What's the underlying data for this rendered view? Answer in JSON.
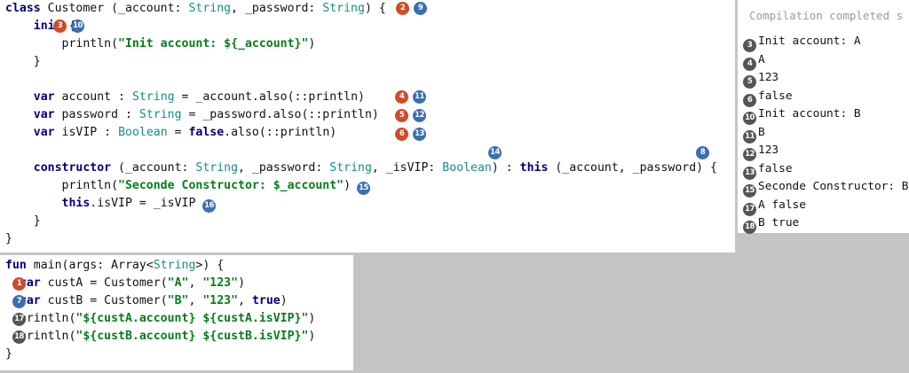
{
  "class_code": [
    [
      "kw:class",
      " Customer (_account: ",
      "ty:String",
      ", _password: ",
      "ty:String",
      ") {"
    ],
    [
      "    ",
      "kw:init",
      " {"
    ],
    [
      "        println(",
      "st:\"Init account: ${_account}\"",
      ")"
    ],
    [
      "    }"
    ],
    [
      ""
    ],
    [
      "    ",
      "kw:var",
      " account : ",
      "ty:String",
      " = _account.also(::println)"
    ],
    [
      "    ",
      "kw:var",
      " password : ",
      "ty:String",
      " = _password.also(::println)"
    ],
    [
      "    ",
      "kw:var",
      " isVIP : ",
      "ty:Boolean",
      " = ",
      "kw:false",
      ".also(::println)"
    ],
    [
      ""
    ],
    [
      "    ",
      "kw:constructor",
      " (_account: ",
      "ty:String",
      ", _password: ",
      "ty:String",
      ", _isVIP: ",
      "ty:Boolean",
      ") : ",
      "kw:this",
      " (_account, _password) {"
    ],
    [
      "        println(",
      "st:\"Seconde Constructor: $_account\"",
      ")"
    ],
    [
      "        ",
      "kw:this",
      ".isVIP = _isVIP"
    ],
    [
      "    }"
    ],
    [
      "}"
    ]
  ],
  "main_code": [
    [
      "kw:fun",
      " main(args: Array<",
      "ty:String",
      ">) {"
    ],
    [
      "  ",
      "kw:var",
      " custA = Customer(",
      "st:\"A\"",
      ", ",
      "st:\"123\"",
      ")"
    ],
    [
      "  ",
      "kw:var",
      " custB = Customer(",
      "st:\"B\"",
      ", ",
      "st:\"123\"",
      ", ",
      "kw:true",
      ")"
    ],
    [
      "  println(",
      "st:\"${custA.account} ${custA.isVIP}\"",
      ")"
    ],
    [
      "  println(",
      "st:\"${custB.account} ${custB.isVIP}\"",
      ")"
    ],
    [
      "}"
    ]
  ],
  "code_badges": [
    {
      "num": "2",
      "color": "red"
    },
    {
      "num": "9",
      "color": "blue"
    },
    {
      "num": "3",
      "color": "red"
    },
    {
      "num": "10",
      "color": "blue"
    },
    {
      "num": "4",
      "color": "red"
    },
    {
      "num": "11",
      "color": "blue"
    },
    {
      "num": "5",
      "color": "red"
    },
    {
      "num": "12",
      "color": "blue"
    },
    {
      "num": "6",
      "color": "red"
    },
    {
      "num": "13",
      "color": "blue"
    },
    {
      "num": "14",
      "color": "blue"
    },
    {
      "num": "8",
      "color": "blue"
    },
    {
      "num": "15",
      "color": "blue"
    },
    {
      "num": "16",
      "color": "blue"
    },
    {
      "num": "1",
      "color": "red"
    },
    {
      "num": "7",
      "color": "blue"
    },
    {
      "num": "17",
      "color": "gray"
    },
    {
      "num": "18",
      "color": "gray"
    }
  ],
  "output_panel": {
    "status": "Compilation completed s",
    "lines": [
      {
        "num": "3",
        "text": "Init account: A"
      },
      {
        "num": "4",
        "text": "A"
      },
      {
        "num": "5",
        "text": "123"
      },
      {
        "num": "6",
        "text": "false"
      },
      {
        "num": "10",
        "text": "Init account: B"
      },
      {
        "num": "11",
        "text": "B"
      },
      {
        "num": "12",
        "text": "123"
      },
      {
        "num": "13",
        "text": "false"
      },
      {
        "num": "15",
        "text": "Seconde Constructor: B"
      },
      {
        "num": "17",
        "text": "A false"
      },
      {
        "num": "18",
        "text": "B true"
      }
    ]
  },
  "colors": {
    "keyword": "#000080",
    "type": "#1b8a8a",
    "string": "#067d17",
    "badge_red": "#cf4b2a",
    "badge_blue": "#3a6fb0",
    "badge_gray": "#555555"
  }
}
